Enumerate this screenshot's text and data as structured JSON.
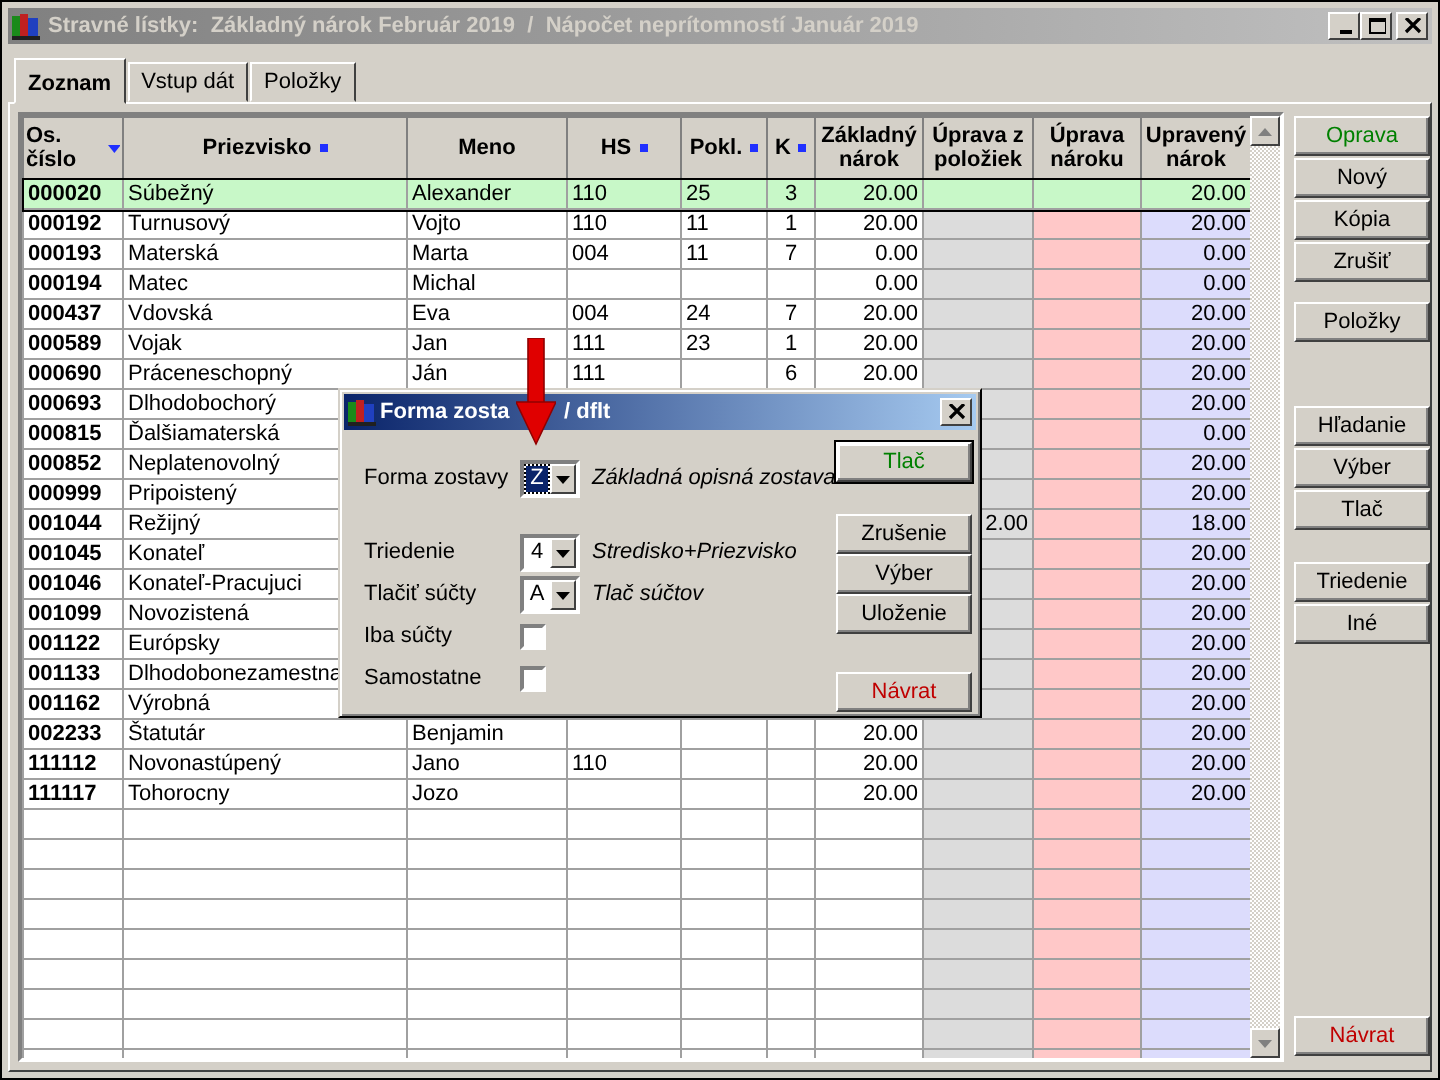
{
  "window": {
    "title": "Stravné lístky:  Základný nárok Február 2019  /  Nápočet neprítomností Január 2019"
  },
  "tabs": [
    {
      "label": "Zoznam",
      "selected": true
    },
    {
      "label": "Vstup dát",
      "selected": false
    },
    {
      "label": "Položky",
      "selected": false
    }
  ],
  "table": {
    "columns": [
      {
        "label": "Os. číslo",
        "sorted": true,
        "flagged": false,
        "kind": "id"
      },
      {
        "label": "Priezvisko",
        "sorted": false,
        "flagged": true,
        "kind": "text"
      },
      {
        "label": "Meno",
        "sorted": false,
        "flagged": false,
        "kind": "text"
      },
      {
        "label": "HS",
        "sorted": false,
        "flagged": true,
        "kind": "text"
      },
      {
        "label": "Pokl.",
        "sorted": false,
        "flagged": true,
        "kind": "text"
      },
      {
        "label": "K",
        "sorted": false,
        "flagged": true,
        "kind": "center"
      },
      {
        "label": "Základný nárok",
        "sorted": false,
        "flagged": false,
        "kind": "number"
      },
      {
        "label": "Úprava z položiek",
        "sorted": false,
        "flagged": false,
        "kind": "number",
        "color": "#dcdcdc"
      },
      {
        "label": "Úprava nároku",
        "sorted": false,
        "flagged": false,
        "kind": "number",
        "color": "#ffc8c8"
      },
      {
        "label": "Upravený nárok",
        "sorted": false,
        "flagged": false,
        "kind": "number",
        "color": "#dcdcfc"
      }
    ],
    "rows": [
      {
        "selected": true,
        "cells": [
          "000020",
          "Súbežný",
          "Alexander",
          "110",
          "25",
          "3",
          "20.00",
          null,
          null,
          "20.00"
        ]
      },
      {
        "selected": false,
        "cells": [
          "000192",
          "Turnusový",
          "Vojto",
          "110",
          "11",
          "1",
          "20.00",
          null,
          null,
          "20.00"
        ]
      },
      {
        "selected": false,
        "cells": [
          "000193",
          "Materská",
          "Marta",
          "004",
          "11",
          "7",
          "0.00",
          null,
          null,
          "0.00"
        ]
      },
      {
        "selected": false,
        "cells": [
          "000194",
          "Matec",
          "Michal",
          null,
          null,
          null,
          "0.00",
          null,
          null,
          "0.00"
        ]
      },
      {
        "selected": false,
        "cells": [
          "000437",
          "Vdovská",
          "Eva",
          "004",
          "24",
          "7",
          "20.00",
          null,
          null,
          "20.00"
        ]
      },
      {
        "selected": false,
        "cells": [
          "000589",
          "Vojak",
          "Jan",
          "111",
          "23",
          "1",
          "20.00",
          null,
          null,
          "20.00"
        ]
      },
      {
        "selected": false,
        "cells": [
          "000690",
          "Práceneschopný",
          "Ján",
          "111",
          null,
          "6",
          "20.00",
          null,
          null,
          "20.00"
        ]
      },
      {
        "selected": false,
        "cells": [
          "000693",
          "Dlhodobochorý",
          null,
          null,
          null,
          null,
          null,
          null,
          null,
          "20.00"
        ]
      },
      {
        "selected": false,
        "cells": [
          "000815",
          "Ďalšiamaterská",
          null,
          null,
          null,
          null,
          null,
          null,
          null,
          "0.00"
        ]
      },
      {
        "selected": false,
        "cells": [
          "000852",
          "Neplatenovolný",
          null,
          null,
          null,
          null,
          null,
          null,
          null,
          "20.00"
        ]
      },
      {
        "selected": false,
        "cells": [
          "000999",
          "Pripoistený",
          null,
          null,
          null,
          null,
          null,
          null,
          null,
          "20.00"
        ]
      },
      {
        "selected": false,
        "cells": [
          "001044",
          "Režijný",
          null,
          null,
          null,
          null,
          null,
          "2.00",
          null,
          "18.00"
        ]
      },
      {
        "selected": false,
        "cells": [
          "001045",
          "Konateľ",
          null,
          null,
          null,
          null,
          null,
          null,
          null,
          "20.00"
        ]
      },
      {
        "selected": false,
        "cells": [
          "001046",
          "Konateľ-Pracujuci",
          null,
          null,
          null,
          null,
          null,
          null,
          null,
          "20.00"
        ]
      },
      {
        "selected": false,
        "cells": [
          "001099",
          "Novozistená",
          null,
          null,
          null,
          null,
          null,
          null,
          null,
          "20.00"
        ]
      },
      {
        "selected": false,
        "cells": [
          "001122",
          "Európsky",
          null,
          null,
          null,
          null,
          null,
          null,
          null,
          "20.00"
        ]
      },
      {
        "selected": false,
        "cells": [
          "001133",
          "Dlhodobonezamestna",
          null,
          null,
          null,
          null,
          null,
          null,
          null,
          "20.00"
        ]
      },
      {
        "selected": false,
        "cells": [
          "001162",
          "Výrobná",
          null,
          null,
          null,
          null,
          null,
          null,
          null,
          "20.00"
        ]
      },
      {
        "selected": false,
        "cells": [
          "002233",
          "Štatutár",
          "Benjamin",
          null,
          null,
          null,
          "20.00",
          null,
          null,
          "20.00"
        ]
      },
      {
        "selected": false,
        "cells": [
          "111112",
          "Novonastúpený",
          "Jano",
          "110",
          null,
          null,
          "20.00",
          null,
          null,
          "20.00"
        ]
      },
      {
        "selected": false,
        "cells": [
          "111117",
          "Tohorocny",
          "Jozo",
          null,
          null,
          null,
          "20.00",
          null,
          null,
          "20.00"
        ]
      }
    ]
  },
  "right_panel": {
    "groups": [
      [
        {
          "label": "Oprava",
          "color": "#008000"
        },
        {
          "label": "Nový",
          "color": "#000000"
        },
        {
          "label": "Kópia",
          "color": "#000000"
        },
        {
          "label": "Zrušiť",
          "color": "#000000"
        }
      ],
      [
        {
          "label": "Položky",
          "color": "#000000"
        }
      ],
      [
        {
          "label": "Hľadanie",
          "color": "#000000"
        },
        {
          "label": "Výber",
          "color": "#000000"
        },
        {
          "label": "Tlač",
          "color": "#000000"
        }
      ],
      [
        {
          "label": "Triedenie",
          "color": "#000000"
        },
        {
          "label": "Iné",
          "color": "#000000"
        }
      ]
    ],
    "footer": {
      "label": "Návrat",
      "color": "#c00000"
    }
  },
  "dialog": {
    "title": "Forma zosta",
    "title_end": "/ dflt",
    "fields": [
      {
        "kind": "combo",
        "label": "Forma zostavy",
        "value": "Z",
        "focused": true,
        "description": "Základná opisná zostava",
        "separated": false
      },
      {
        "kind": "combo",
        "label": "Triedenie",
        "value": "4",
        "focused": false,
        "description": "Stredisko+Priezvisko",
        "separated": true
      },
      {
        "kind": "combo",
        "label": "Tlačiť súčty",
        "value": "A",
        "focused": false,
        "description": "Tlač súčtov",
        "separated": false
      },
      {
        "kind": "checkbox",
        "label": "Iba súčty",
        "checked": false,
        "separated": false
      },
      {
        "kind": "checkbox",
        "label": "Samostatne",
        "checked": false,
        "separated": false
      }
    ],
    "button_groups": [
      [
        {
          "label": "Tlač",
          "color": "#008000",
          "default": true
        }
      ],
      [
        {
          "label": "Zrušenie",
          "color": "#000000",
          "default": false
        },
        {
          "label": "Výber",
          "color": "#000000",
          "default": false
        },
        {
          "label": "Uloženie",
          "color": "#000000",
          "default": false
        }
      ],
      [
        {
          "label": "Návrat",
          "color": "#c00000",
          "default": false
        }
      ]
    ]
  }
}
